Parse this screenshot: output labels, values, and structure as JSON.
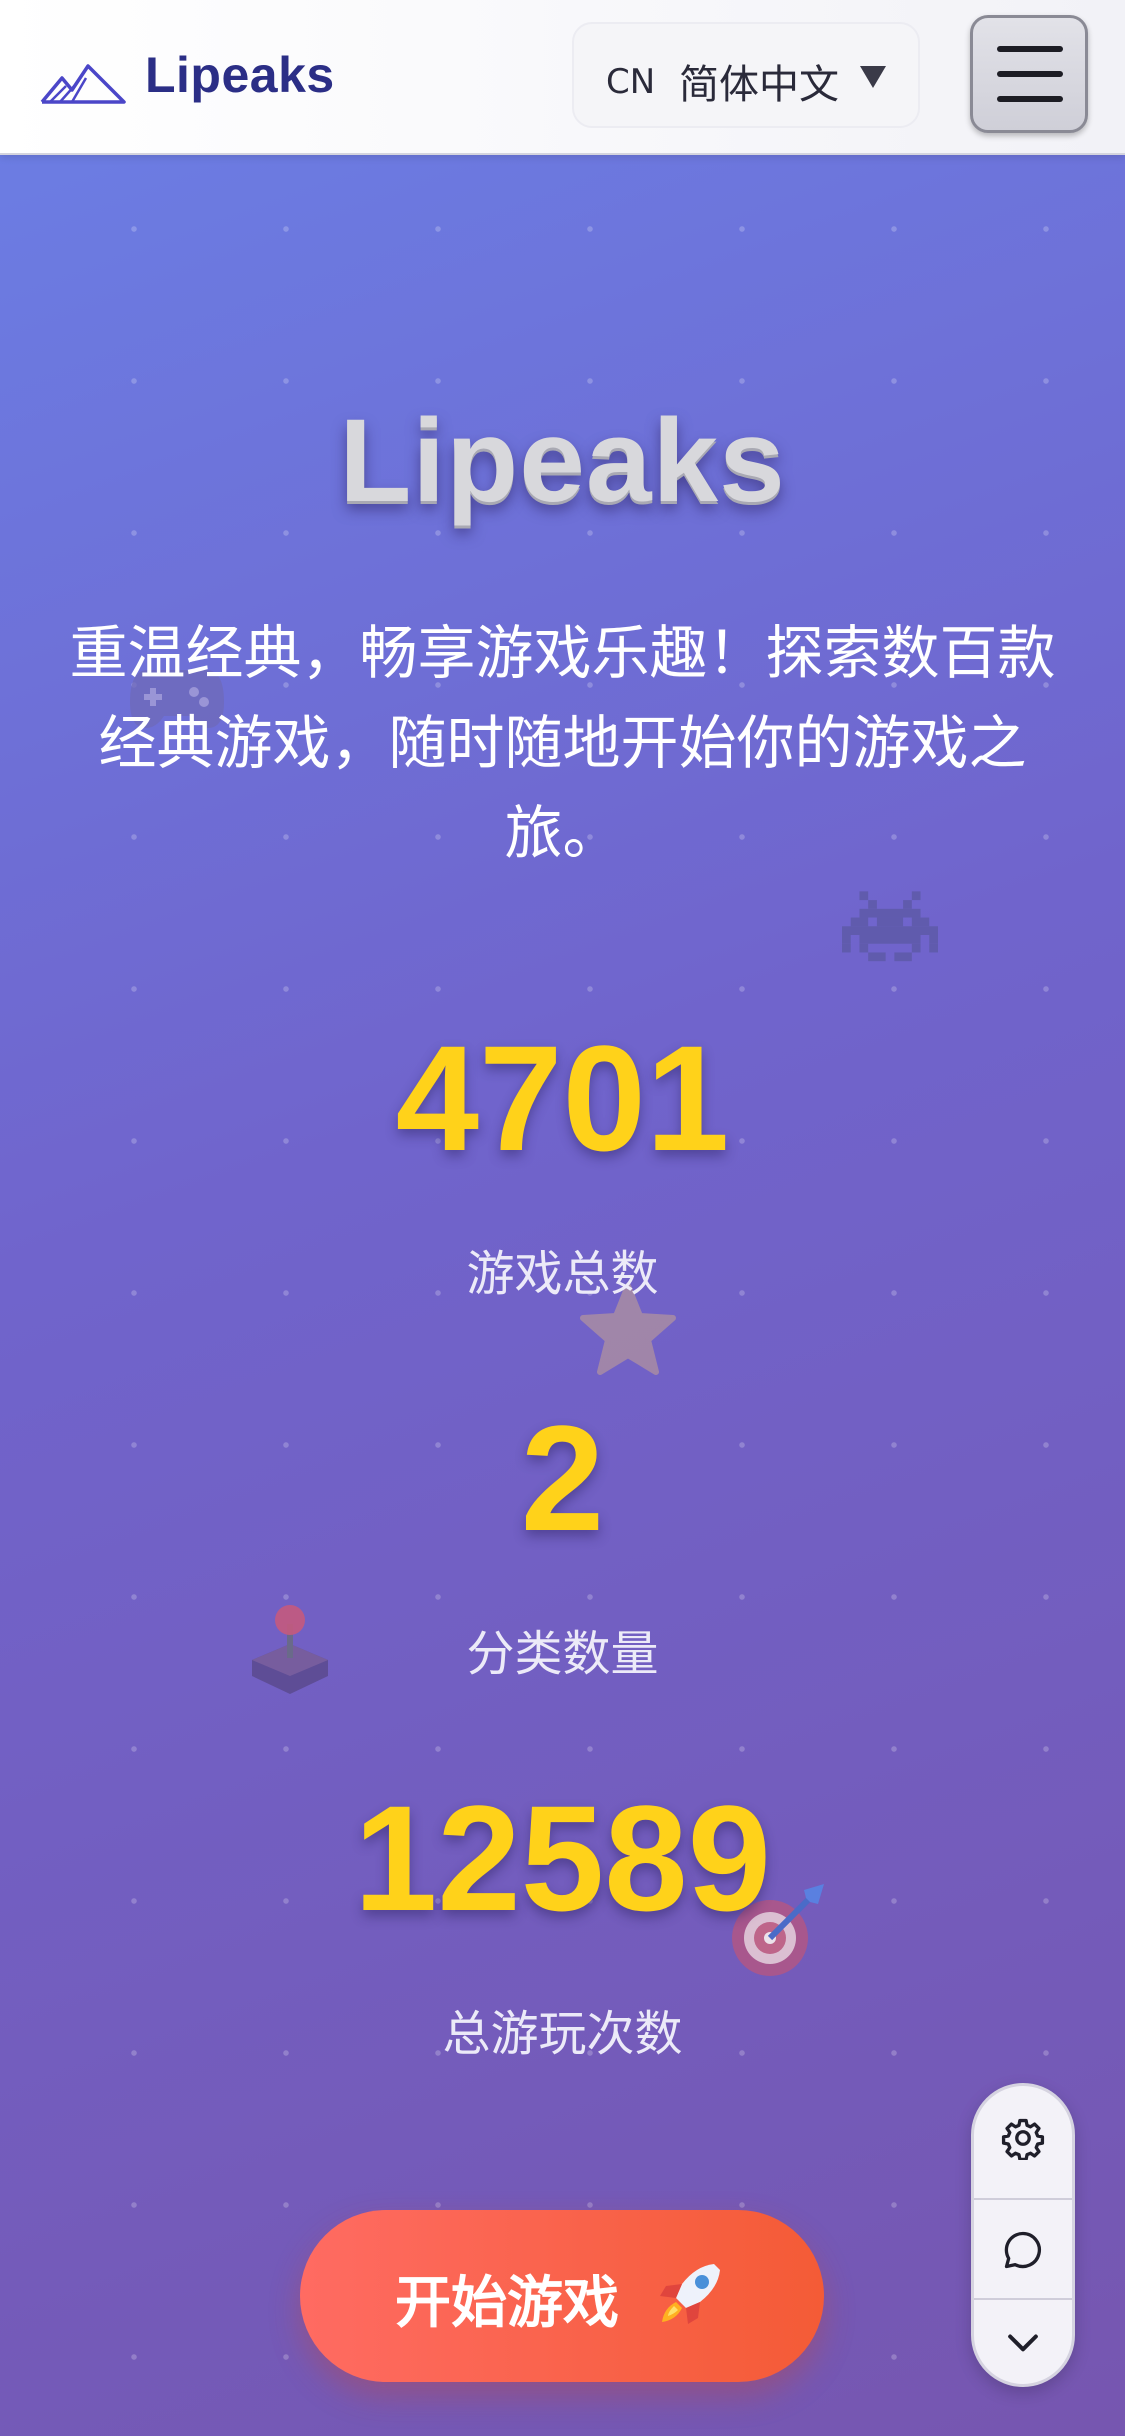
{
  "header": {
    "logo_text": "Lipeaks",
    "logo_icon": "mountain-icon",
    "language": {
      "code": "CN",
      "name": "简体中文",
      "icon": "caret-down-icon"
    },
    "menu_icon": "hamburger-icon"
  },
  "hero": {
    "title": "Lipeaks",
    "subtitle": "重温经典，畅享游戏乐趣！探索数百款经典游戏，随时随地开始你的游戏之旅。"
  },
  "stats": [
    {
      "value": "4701",
      "label": "游戏总数"
    },
    {
      "value": "2",
      "label": "分类数量"
    },
    {
      "value": "12589",
      "label": "总游玩次数"
    }
  ],
  "cta": {
    "label": "开始游戏",
    "icon": "rocket-icon"
  },
  "side_panel": {
    "icons": [
      "gear-icon",
      "chat-bubble-icon",
      "chevron-down-icon"
    ]
  },
  "decorations": [
    "gamepad-icon",
    "space-invader-icon",
    "star-icon",
    "joystick-icon",
    "target-icon"
  ],
  "colors": {
    "accent": "#ffd21a",
    "cta": "#f45b36",
    "brand": "#2b2e86"
  }
}
